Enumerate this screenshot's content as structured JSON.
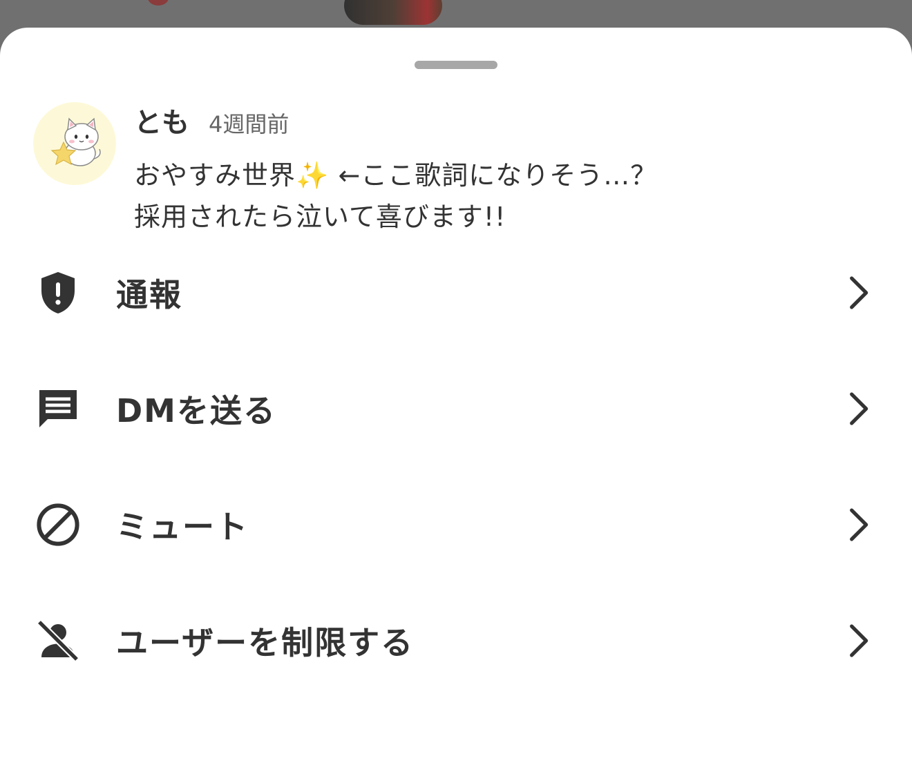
{
  "comment": {
    "username": "とも",
    "timestamp": "4週間前",
    "text_line1": "おやすみ世界✨ ←ここ歌詞になりそう…？",
    "text_line2": "採用されたら泣いて喜びます!!"
  },
  "menu": {
    "items": [
      {
        "label": "通報",
        "icon": "report-shield-icon"
      },
      {
        "label": "DMを送る",
        "icon": "message-icon"
      },
      {
        "label": "ミュート",
        "icon": "mute-block-icon"
      },
      {
        "label": "ユーザーを制限する",
        "icon": "restrict-user-icon"
      }
    ]
  },
  "colors": {
    "text": "#333333",
    "subtext": "#666666",
    "avatar_bg": "#fdf9d8",
    "handle": "#a7a7a7"
  }
}
